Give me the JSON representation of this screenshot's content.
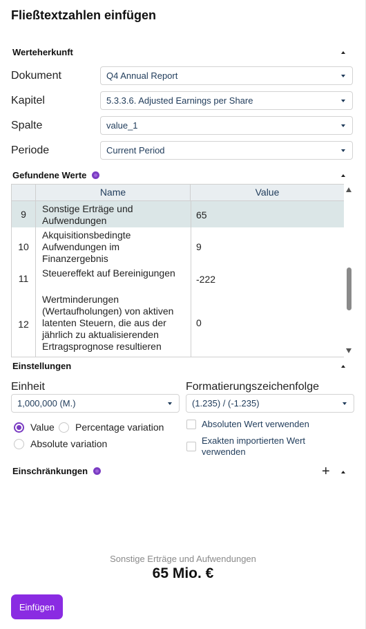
{
  "title": "Fließtextzahlen einfügen",
  "source": {
    "heading": "Werteherkunft",
    "fields": [
      {
        "label": "Dokument",
        "value": "Q4 Annual Report"
      },
      {
        "label": "Kapitel",
        "value": "5.3.3.6. Adjusted Earnings per Share"
      },
      {
        "label": "Spalte",
        "value": "value_1"
      },
      {
        "label": "Periode",
        "value": "Current Period"
      }
    ]
  },
  "found": {
    "heading": "Gefundene Werte",
    "columns": [
      "Name",
      "Value"
    ],
    "rows": [
      {
        "idx": "9",
        "name": "Sonstige Erträge und Aufwendungen",
        "value": "65",
        "selected": true
      },
      {
        "idx": "10",
        "name": "Akquisitionsbedingte Aufwendungen im Finanzergebnis",
        "value": "9",
        "selected": false
      },
      {
        "idx": "11",
        "name": "Steuereffekt auf Bereinigungen",
        "value": "-222",
        "selected": false
      },
      {
        "idx": "12",
        "name": "Wertminderungen (Wertaufholungen) von aktiven latenten Steuern, die aus der jährlich zu aktualisierenden Ertragsprognose resultieren",
        "value": "0",
        "selected": false
      }
    ]
  },
  "settings": {
    "heading": "Einstellungen",
    "unit_label": "Einheit",
    "unit_value": "1,000,000 (M.)",
    "format_label": "Formatierungszeichenfolge",
    "format_value": "(1.235) / (-1.235)",
    "radio_value": "Value",
    "radio_percentage": "Percentage variation",
    "radio_absolute": "Absolute variation",
    "radio_selected": "Value",
    "cb_absolute": "Absoluten Wert verwenden",
    "cb_exact_line1": "Exakten importierten Wert",
    "cb_exact_line2": "verwenden"
  },
  "constraints": {
    "heading": "Einschränkungen",
    "add_symbol": "+"
  },
  "summary": {
    "label": "Sonstige Erträge und Aufwendungen",
    "value": "65 Mio. €"
  },
  "insert_button": "Einfügen",
  "colors": {
    "accent": "#8a2be2",
    "selected_row": "#dbe6e7",
    "header_bg": "#e9eef1"
  }
}
